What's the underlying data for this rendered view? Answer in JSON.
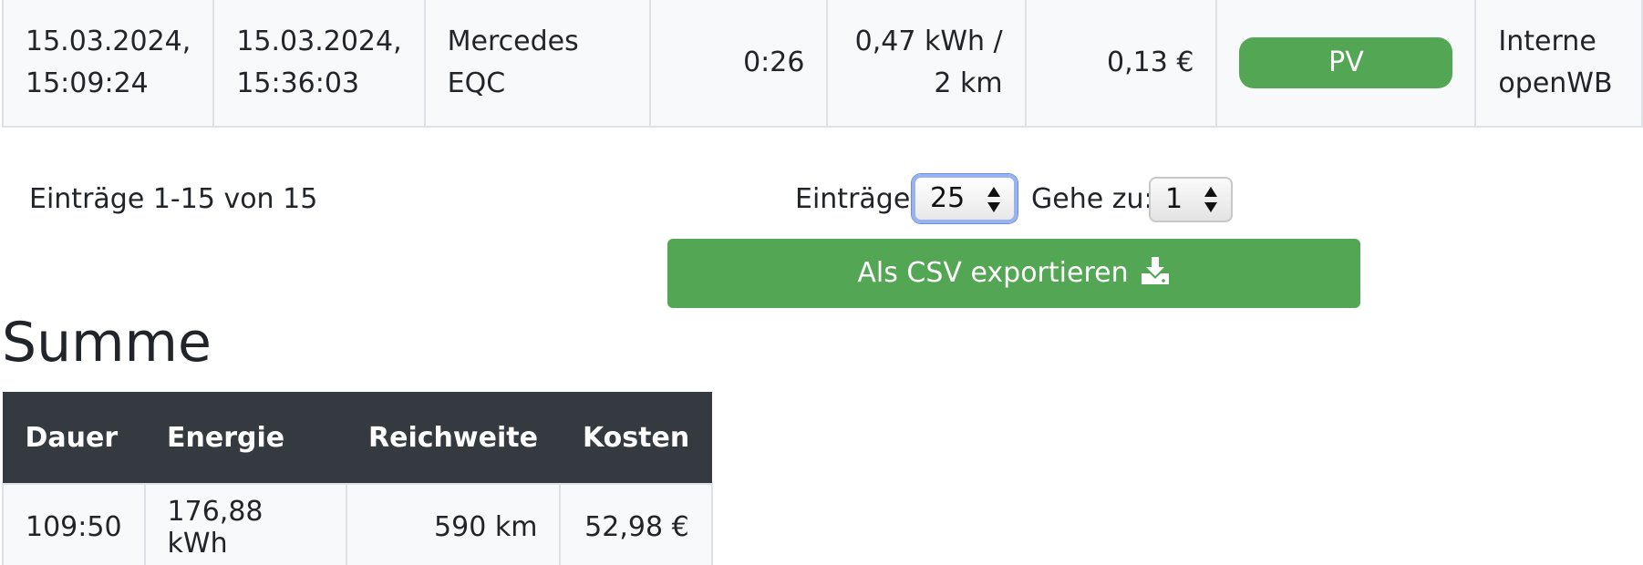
{
  "log_row": {
    "start_date": "15.03.2024,",
    "start_time": "15:09:24",
    "end_date": "15.03.2024,",
    "end_time": "15:36:03",
    "vehicle_line1": "Mercedes",
    "vehicle_line2": "EQC",
    "duration": "0:26",
    "energy_line1": "0,47 kWh /",
    "energy_line2": "2 km",
    "cost": "0,13 €",
    "mode": "PV",
    "chargepoint_line1": "Interne",
    "chargepoint_line2": "openWB"
  },
  "pagination": {
    "entries_info": "Einträge 1-15 von 15",
    "page_size_label": "Einträge:",
    "page_size_value": "25",
    "goto_label": "Gehe zu:",
    "goto_value": "1"
  },
  "export": {
    "label": "Als CSV exportieren",
    "icon": "download-icon"
  },
  "summary": {
    "title": "Summe",
    "headers": {
      "duration": "Dauer",
      "energy": "Energie",
      "range": "Reichweite",
      "cost": "Kosten"
    },
    "values": {
      "duration": "109:50",
      "energy": "176,88 kWh",
      "range": "590 km",
      "cost": "52,98 €"
    }
  },
  "colors": {
    "accent_green": "#53a653",
    "header_dark": "#343a40",
    "row_background": "#f8f9fa",
    "focus_ring": "#99b3f0"
  }
}
